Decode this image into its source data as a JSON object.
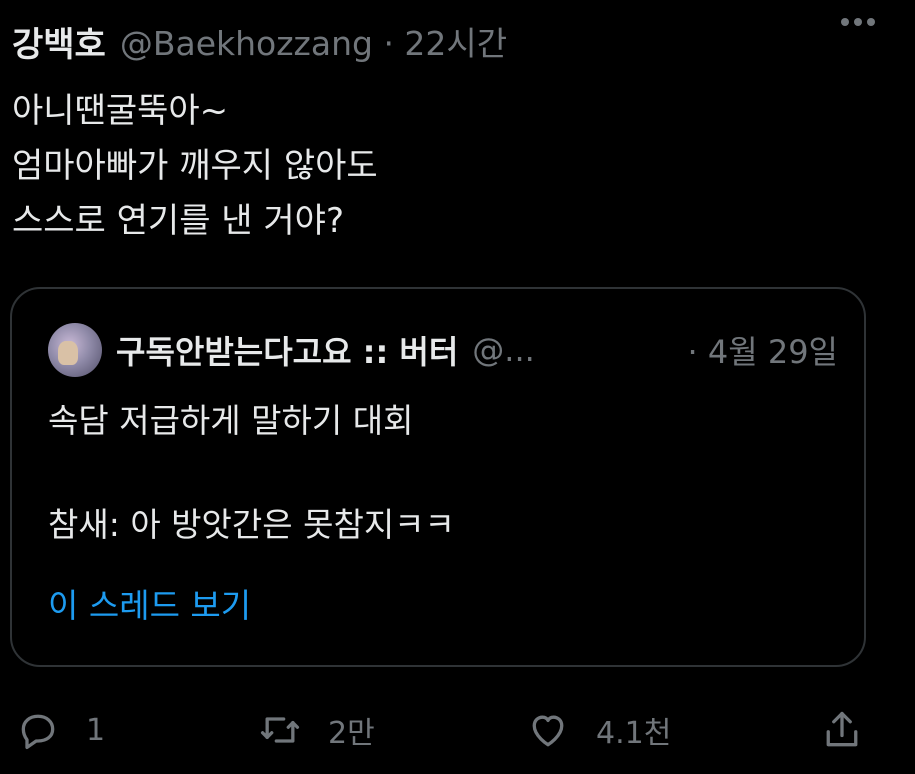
{
  "tweet": {
    "author_name": "강백호",
    "author_meta": "@Baekhozzang · 22시간",
    "lines": [
      "아니땐굴뚝아~",
      "엄마아빠가 깨우지 않아도",
      "스스로 연기를 낸 거야?"
    ]
  },
  "quote": {
    "name": "구독안받는다고요 :: 버터",
    "handle": "@...",
    "date": "· 4월 29일",
    "lines": [
      "속담 저급하게 말하기 대회",
      "",
      "참새: 아 방앗간은 못참지ㅋㅋ"
    ],
    "show_thread": "이 스레드 보기"
  },
  "actions": {
    "reply_count": "1",
    "retweet_count": "2만",
    "like_count": "4.1천"
  },
  "icons": {
    "more": "more-icon",
    "reply": "reply-icon",
    "retweet": "retweet-icon",
    "like": "like-icon",
    "share": "share-icon"
  },
  "colors": {
    "background": "#000000",
    "text": "#e7e9ea",
    "muted": "#71767b",
    "link": "#1d9bf0",
    "border": "#2f3336"
  }
}
